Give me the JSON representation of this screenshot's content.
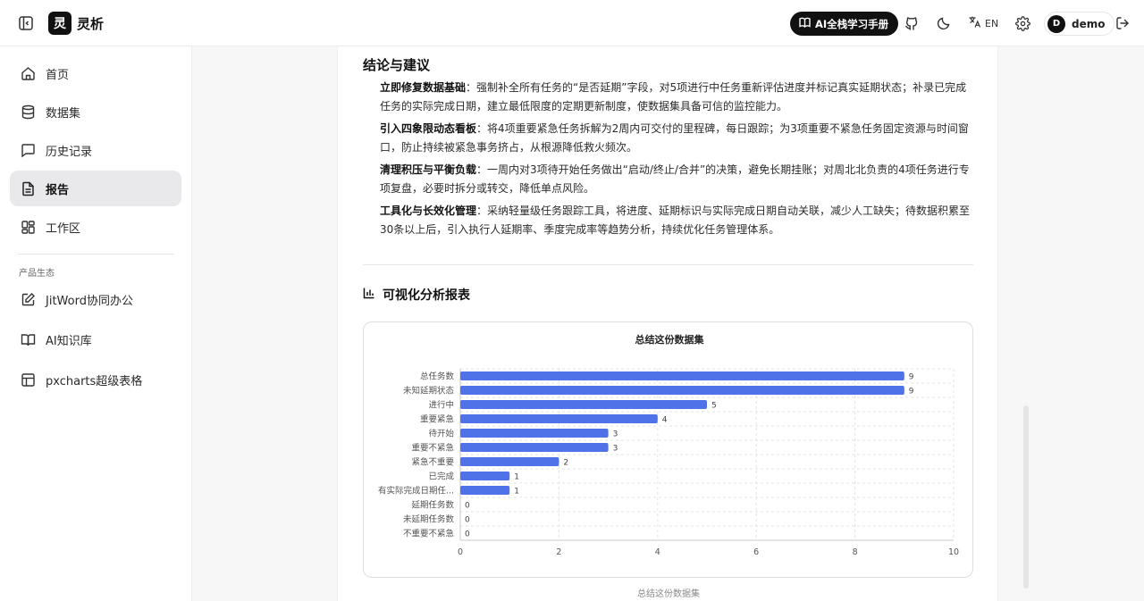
{
  "header": {
    "brand_logo_char": "灵",
    "brand_name": "灵析",
    "ai_manual_label": "AI全栈学习手册",
    "lang_label": "EN",
    "user_avatar": "D",
    "user_name": "demo"
  },
  "sidebar": {
    "items": [
      {
        "label": "首页",
        "icon": "home-icon"
      },
      {
        "label": "数据集",
        "icon": "database-icon"
      },
      {
        "label": "历史记录",
        "icon": "chat-history-icon"
      },
      {
        "label": "报告",
        "icon": "report-document-icon",
        "active": true
      },
      {
        "label": "工作区",
        "icon": "workspace-grid-icon"
      }
    ],
    "section_label": "产品生态",
    "eco_items": [
      {
        "label": "JitWord协同办公",
        "icon": "edit-pen-icon"
      },
      {
        "label": "AI知识库",
        "icon": "open-book-icon"
      },
      {
        "label": "pxcharts超级表格",
        "icon": "table-icon"
      }
    ]
  },
  "report": {
    "section_title": "结论与建议",
    "items": [
      {
        "title": "立即修复数据基础",
        "text": "：强制补全所有任务的“是否延期”字段，对5项进行中任务重新评估进度并标记真实延期状态；补录已完成任务的实际完成日期，建立最低限度的定期更新制度，使数据集具备可信的监控能力。"
      },
      {
        "title": "引入四象限动态看板",
        "text": "：将4项重要紧急任务拆解为2周内可交付的里程碑，每日跟踪；为3项重要不紧急任务固定资源与时间窗口，防止持续被紧急事务挤占，从根源降低救火频次。"
      },
      {
        "title": "清理积压与平衡负载",
        "text": "：一周内对3项待开始任务做出“启动/终止/合并”的决策，避免长期挂账；对周北北负责的4项任务进行专项复盘，必要时拆分或转交，降低单点风险。"
      },
      {
        "title": "工具化与长效化管理",
        "text": "：采纳轻量级任务跟踪工具，将进度、延期标识与实际完成日期自动关联，减少人工缺失；待数据积累至30条以上后，引入执行人延期率、季度完成率等趋势分析，持续优化任务管理体系。"
      }
    ],
    "viz_title": "可视化分析报表",
    "chart_caption": "总结这份数据集"
  },
  "colors": {
    "bar": "#4f72e8",
    "grid": "#e3e3e6",
    "axis_text": "#555555"
  },
  "chart_data": {
    "type": "bar",
    "orientation": "horizontal",
    "title": "总结这份数据集",
    "categories": [
      "总任务数",
      "未知延期状态",
      "进行中",
      "重要紧急",
      "待开始",
      "重要不紧急",
      "紧急不重要",
      "已完成",
      "有实际完成日期任...",
      "延期任务数",
      "未延期任务数",
      "不重要不紧急"
    ],
    "values": [
      9,
      9,
      5,
      4,
      3,
      3,
      2,
      1,
      1,
      0,
      0,
      0
    ],
    "xlim": [
      0,
      10
    ],
    "xticks": [
      "0",
      "2",
      "4",
      "6",
      "8",
      "10"
    ],
    "grid": true,
    "legend": "none"
  }
}
